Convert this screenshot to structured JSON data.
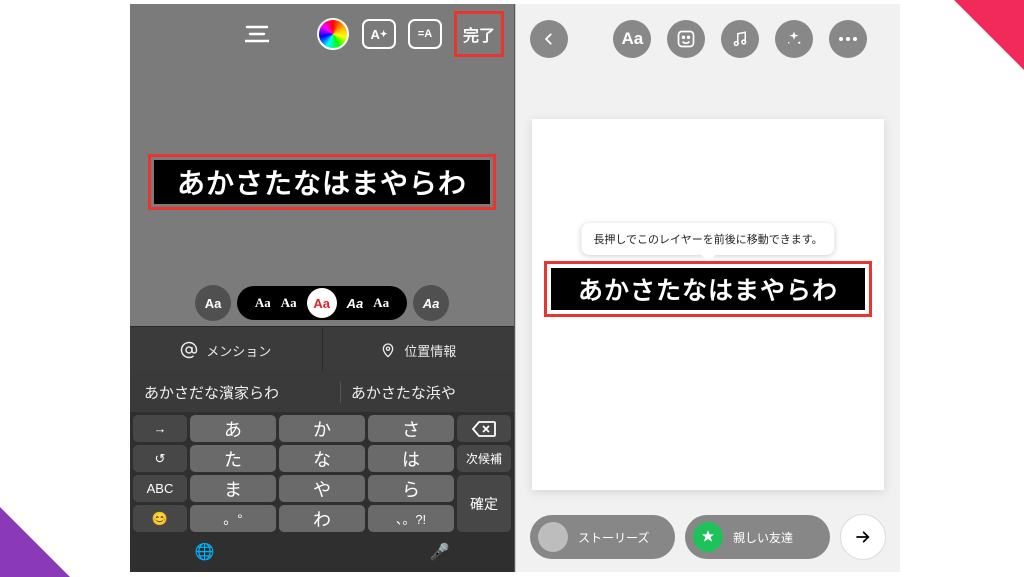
{
  "left": {
    "done_label": "完了",
    "typed_text": "あかさたなはまやらわ",
    "font_chips": {
      "outerA": "Aa",
      "b1": "Aa",
      "b2": "Aa",
      "sel": "Aa",
      "b3": "Aa",
      "b4": "Aa",
      "outerB": "Aa"
    },
    "tags": {
      "mention": "メンション",
      "location": "位置情報"
    },
    "suggestions": {
      "s1": "あかさだな濱家らわ",
      "s2": "あかさたな浜や"
    },
    "keys": {
      "r1": [
        "→",
        "あ",
        "か",
        "さ",
        "⌫"
      ],
      "r2": [
        "↺",
        "た",
        "な",
        "は",
        "次候補"
      ],
      "r3": [
        "ABC",
        "ま",
        "や",
        "ら",
        "確定"
      ],
      "r4": [
        "😊",
        "。°",
        "わ",
        "、。?!",
        ""
      ]
    },
    "bottom_icons": [
      "🌐",
      "🎤"
    ]
  },
  "right": {
    "tooltip": "長押しでこのレイヤーを前後に移動できます。",
    "placed_text": "あかさたなはまやらわ",
    "share": {
      "stories": "ストーリーズ",
      "close": "親しい友達"
    }
  }
}
